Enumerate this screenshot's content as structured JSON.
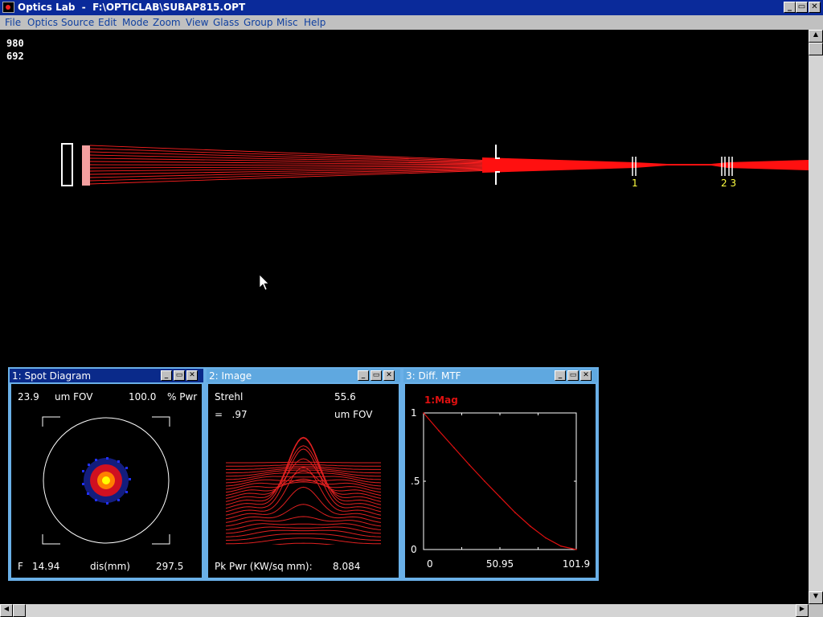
{
  "app": {
    "title": "Optics Lab  -  F:\\OPTICLAB\\SUBAP815.OPT"
  },
  "window_controls": {
    "minimize": "_",
    "maximize": "▭",
    "close": "✕"
  },
  "menu": [
    "File",
    "Optics",
    "Source",
    "Edit",
    "Mode",
    "Zoom",
    "View",
    "Glass",
    "Group",
    "Misc",
    "Help"
  ],
  "coords": {
    "x": "980",
    "y": "692"
  },
  "layout_labels": {
    "element1": "1",
    "element23": "2 3"
  },
  "spot": {
    "title": "1: Spot Diagram",
    "fov_value": "23.9",
    "fov_unit": "um FOV",
    "pwr_value": "100.0",
    "pwr_unit": "% Pwr",
    "f_label": "F",
    "f_value": "14.94",
    "dis_label": "dis(mm)",
    "dis_value": "297.5"
  },
  "image": {
    "title": "2: Image",
    "strehl_label": "Strehl",
    "strehl_eq": "=   .97",
    "fov_value": "55.6",
    "fov_unit": "um FOV",
    "pk_label": "Pk Pwr (KW/sq mm):",
    "pk_value": "8.084"
  },
  "mtf": {
    "title": "3: Diff. MTF",
    "legend": "1:Mag",
    "legend_color": "#e01010"
  },
  "chart_data": {
    "type": "line",
    "series": [
      {
        "name": "1:Mag",
        "x": [
          0,
          10.19,
          20.38,
          30.57,
          40.76,
          50.95,
          61.14,
          71.33,
          81.52,
          91.71,
          101.9
        ],
        "y": [
          1.0,
          0.87,
          0.745,
          0.62,
          0.5,
          0.385,
          0.27,
          0.17,
          0.085,
          0.025,
          0.0
        ]
      }
    ],
    "xlim": [
      0,
      101.9
    ],
    "ylim": [
      0,
      1
    ],
    "x_tick_labels": [
      "0",
      "50.95",
      "101.9"
    ],
    "y_tick_labels": [
      "1",
      ".5",
      "0"
    ],
    "grid": false
  }
}
